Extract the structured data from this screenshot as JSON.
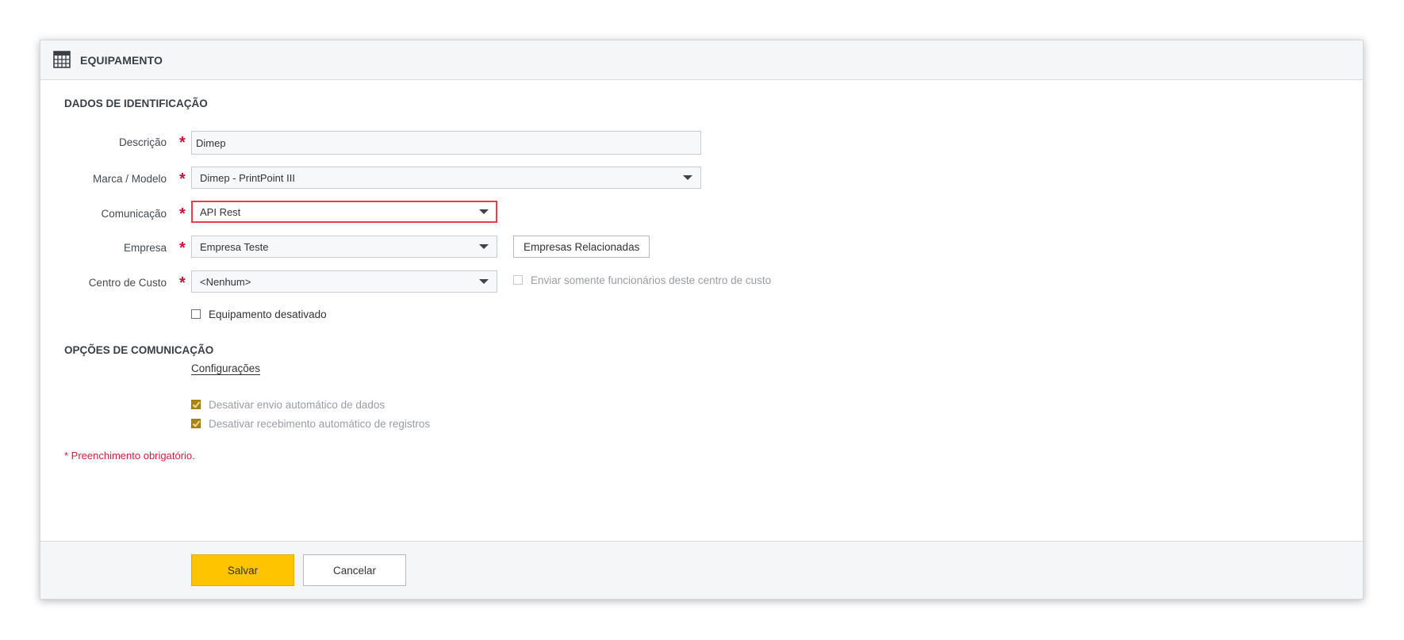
{
  "panel": {
    "title": "EQUIPAMENTO",
    "icon": "calculator-grid-icon"
  },
  "identification": {
    "section_title": "DADOS DE IDENTIFICAÇÃO",
    "descricao": {
      "label": "Descrição",
      "value": "Dimep",
      "required_mark": "*"
    },
    "marca_modelo": {
      "label": "Marca / Modelo",
      "value": "Dimep - PrintPoint III",
      "required_mark": "*"
    },
    "comunicacao": {
      "label": "Comunicação",
      "value": "API Rest",
      "required_mark": "*",
      "state": "error"
    },
    "empresa": {
      "label": "Empresa",
      "value": "Empresa Teste",
      "required_mark": "*",
      "related_button": "Empresas Relacionadas"
    },
    "centro_custo": {
      "label": "Centro de Custo",
      "value": "<Nenhum>",
      "required_mark": "*",
      "only_employees_label": "Enviar somente funcionários deste centro de custo",
      "only_employees_checked": false
    },
    "disabled_equipment": {
      "label": "Equipamento desativado",
      "checked": false
    }
  },
  "communication_options": {
    "section_title": "OPÇÕES DE COMUNICAÇÃO",
    "config_link": "Configurações",
    "disable_auto_send": {
      "label": "Desativar envio automático de dados",
      "checked": true
    },
    "disable_auto_receive": {
      "label": "Desativar recebimento automático de registros",
      "checked": true
    }
  },
  "required_note": "* Preenchimento obrigatório.",
  "footer": {
    "save_label": "Salvar",
    "cancel_label": "Cancelar"
  },
  "colors": {
    "primary_button": "#ffc400",
    "required": "#d0103a",
    "error_border": "#e8404a",
    "checked_box": "#a98512"
  }
}
